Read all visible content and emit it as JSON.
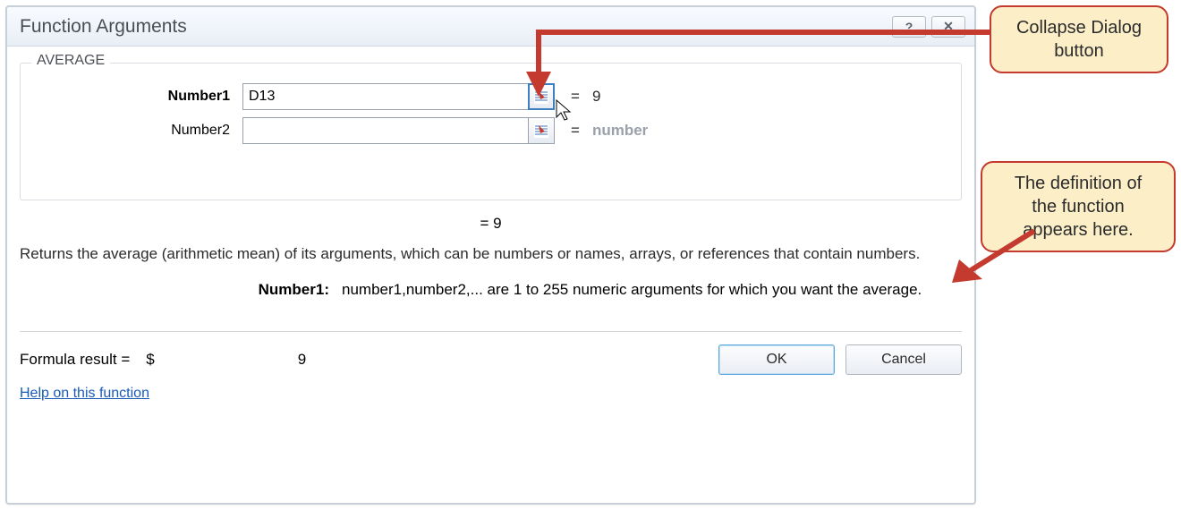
{
  "dialog": {
    "title": "Function Arguments",
    "help_button": "?",
    "close_button": "✕"
  },
  "group": {
    "name": "AVERAGE",
    "args": [
      {
        "label": "Number1",
        "bold": true,
        "value": "D13",
        "highlighted": true,
        "eq": "=",
        "result": "9",
        "dim": false
      },
      {
        "label": "Number2",
        "bold": false,
        "value": "",
        "highlighted": false,
        "eq": "=",
        "result": "number",
        "dim": true
      }
    ]
  },
  "mid": {
    "eq": "=  9"
  },
  "description": "Returns the average (arithmetic mean) of its arguments, which can be numbers or names, arrays, or references that contain numbers.",
  "arg_help": {
    "label": "Number1:",
    "text": "number1,number2,... are 1 to 255 numeric arguments for which you want the average."
  },
  "formula_result": {
    "label": "Formula result =",
    "currency": "$",
    "value": "9"
  },
  "help_link": "Help on this function",
  "buttons": {
    "ok": "OK",
    "cancel": "Cancel"
  },
  "callouts": {
    "collapse": "Collapse Dialog button",
    "definition": "The definition of the function appears here."
  }
}
